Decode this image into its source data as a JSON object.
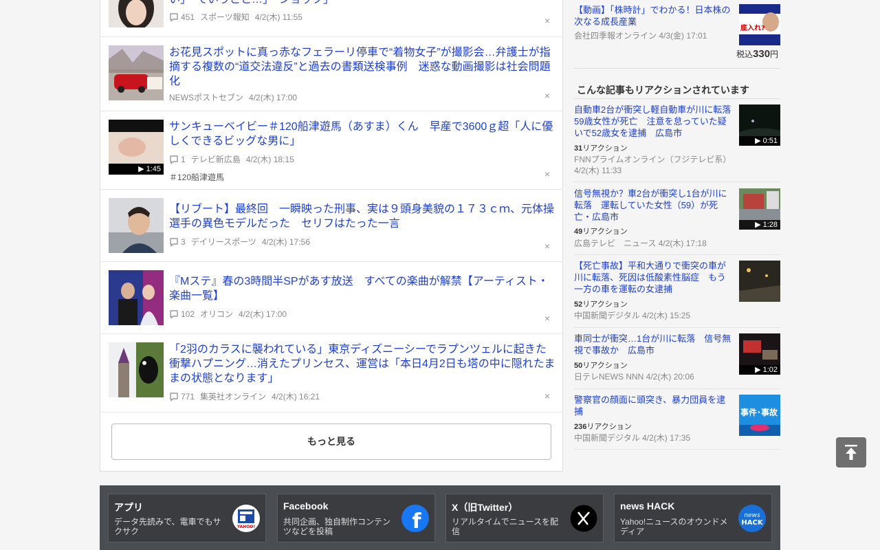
{
  "articles": [
    {
      "title": "い」　でいうこと…」　ジョック」",
      "comments": "451",
      "source": "スポーツ報知",
      "date": "4/2(木) 11:55"
    },
    {
      "title": "お花見スポットに真っ赤なフェラーリ停車で“着物女子”が撮影会…弁護士が指摘する複数の“道交法違反”と過去の書類送検事例　迷惑な動画撮影は社会問題化",
      "source": "NEWSポストセブン",
      "date": "4/2(木) 17:00"
    },
    {
      "title": "サンキューベイビー＃120船津遊馬（あすま）くん　早産で3600ｇ超「人に優しくできるビッグな男に」",
      "comments": "1",
      "source": "テレビ新広島",
      "date": "4/2(木) 18:15",
      "duration": "▶ 1:45",
      "tag": "＃120船津遊馬"
    },
    {
      "title": "【リブート】最終回　一瞬映った刑事、実は９頭身美貌の１７３ｃｍ、元体操選手の異色モデルだった　セリフはたった一言",
      "comments": "3",
      "source": "デイリースポーツ",
      "date": "4/2(木) 17:56"
    },
    {
      "title": "『Mステ』春の3時間半SPがあす放送　すべての楽曲が解禁【アーティスト・楽曲一覧】",
      "comments": "102",
      "source": "オリコン",
      "date": "4/2(木) 17:00"
    },
    {
      "title": "「2羽のカラスに襲われている」東京ディズニーシーでラプンツェルに起きた衝撃ハプニング…消えたプリンセス、運営は「本日4月2日も塔の中に隠れたままの状態となります」",
      "comments": "771",
      "source": "集英社オンライン",
      "date": "4/2(木) 16:21"
    }
  ],
  "close_glyph": "×",
  "more_button": "もっと見る",
  "promo": {
    "title": "【動画】「株時計」でわかる！日本株の次なる成長産業",
    "source": "会社四季報オンライン 4/3(金) 17:01",
    "price_prefix": "税込",
    "price_value": "330",
    "price_suffix": "円",
    "thumb_text": "底入れ?"
  },
  "section_title": "こんな記事もリアクションされています",
  "reaction_suffix": "リアクション",
  "side_items": [
    {
      "title": "自動車2台が衝突し軽自動車が川に転落　59歳女性が死亡　注意を怠っていた疑いで52歳女を逮捕　広島市",
      "reactions": "31",
      "source": "FNNプライムオンライン（フジテレビ系）  4/2(木) 11:33",
      "duration": "▶ 0:51"
    },
    {
      "title": "信号無視か？車2台が衝突し1台が川に転落　運転していた女性（59）が死亡・広島市",
      "reactions": "49",
      "source": "広島テレビ　ニュース 4/2(木) 17:18",
      "duration": "▶ 1:28"
    },
    {
      "title": "【死亡事故】平和大通りで衝突の車が川に転落、死因は低酸素性脳症　もう一方の車を運転の女逮捕",
      "reactions": "52",
      "source": "中国新聞デジタル 4/2(木) 15:25"
    },
    {
      "title": "車同士が衝突…1台が川に転落　信号無視で事故か　広島市",
      "reactions": "50",
      "source": "日テレNEWS NNN 4/2(木) 20:06",
      "duration": "▶ 1:02"
    },
    {
      "title": "警察官の顔面に頭突き、暴力団員を逮捕",
      "reactions": "236",
      "source": "中国新聞デジタル 4/2(木) 17:35",
      "thumb_text": "事件･事故"
    }
  ],
  "footer": [
    {
      "heading": "アプリ",
      "desc": "データ先読みで、電車でもサクサク",
      "icon": "yahoo-app-icon",
      "icon_text": "YAHOO!"
    },
    {
      "heading": "Facebook",
      "desc": "共同企画、独自制作コンテンツなどを投稿",
      "icon": "facebook-icon",
      "icon_text": "f"
    },
    {
      "heading": "X（旧Twitter）",
      "desc": "リアルタイムでニュースを配信",
      "icon": "x-icon",
      "icon_text": "𝕏"
    },
    {
      "heading": "news HACK",
      "desc": "Yahoo!ニュースのオウンドメディア",
      "icon": "news-hack-icon",
      "icon_text": "news HACK"
    }
  ],
  "colors": {
    "link": "#1e3fd0",
    "footer_bg": "#4a4d52",
    "facebook": "#1877f2"
  }
}
